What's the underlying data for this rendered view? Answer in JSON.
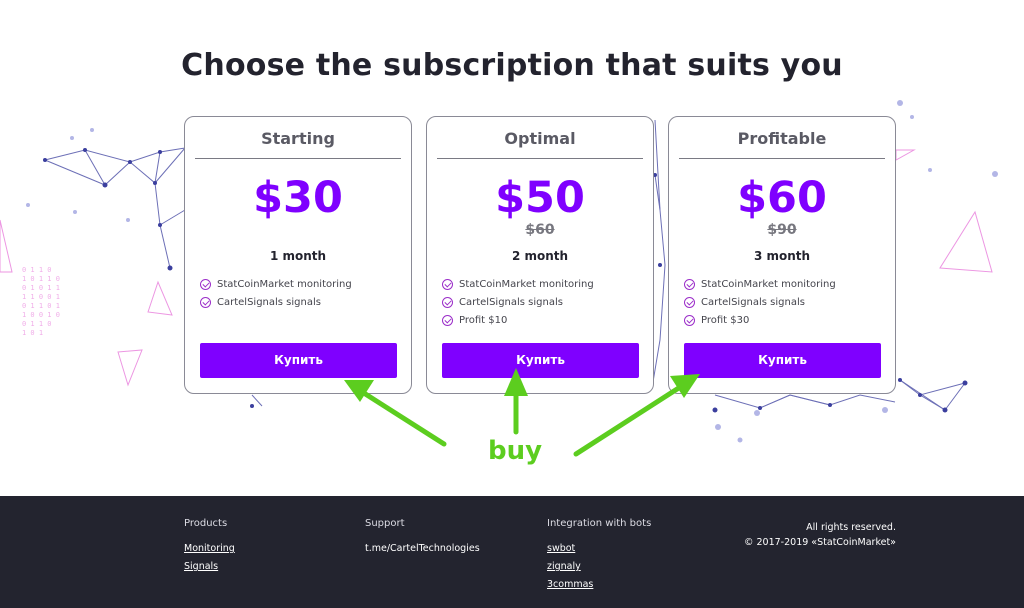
{
  "heading": "Choose the subscription that suits you",
  "plans": [
    {
      "title": "Starting",
      "price": "$30",
      "old_price": "",
      "duration": "1 month",
      "features": [
        "StatCoinMarket monitoring",
        "CartelSignals signals"
      ],
      "button": "Купить"
    },
    {
      "title": "Optimal",
      "price": "$50",
      "old_price": "$60",
      "duration": "2 month",
      "features": [
        "StatCoinMarket monitoring",
        "CartelSignals signals",
        "Profit $10"
      ],
      "button": "Купить"
    },
    {
      "title": "Profitable",
      "price": "$60",
      "old_price": "$90",
      "duration": "3 month",
      "features": [
        "StatCoinMarket monitoring",
        "CartelSignals signals",
        "Profit $30"
      ],
      "button": "Купить"
    }
  ],
  "annotation": {
    "label": "buy",
    "color": "#5ccd1f"
  },
  "colors": {
    "accent": "#7f00ff",
    "footer_bg": "#23242f",
    "check": "#9b2ec9"
  },
  "footer": {
    "products": {
      "title": "Products",
      "links": [
        "Monitoring",
        "Signals"
      ]
    },
    "support": {
      "title": "Support",
      "links": [
        "t.me/CartelTechnologies"
      ]
    },
    "bots": {
      "title": "Integration with bots",
      "links": [
        "swbot",
        "zignaly",
        "3commas"
      ]
    },
    "rights": "All rights reserved.",
    "copyright": "© 2017-2019 «StatCoinMarket»"
  }
}
